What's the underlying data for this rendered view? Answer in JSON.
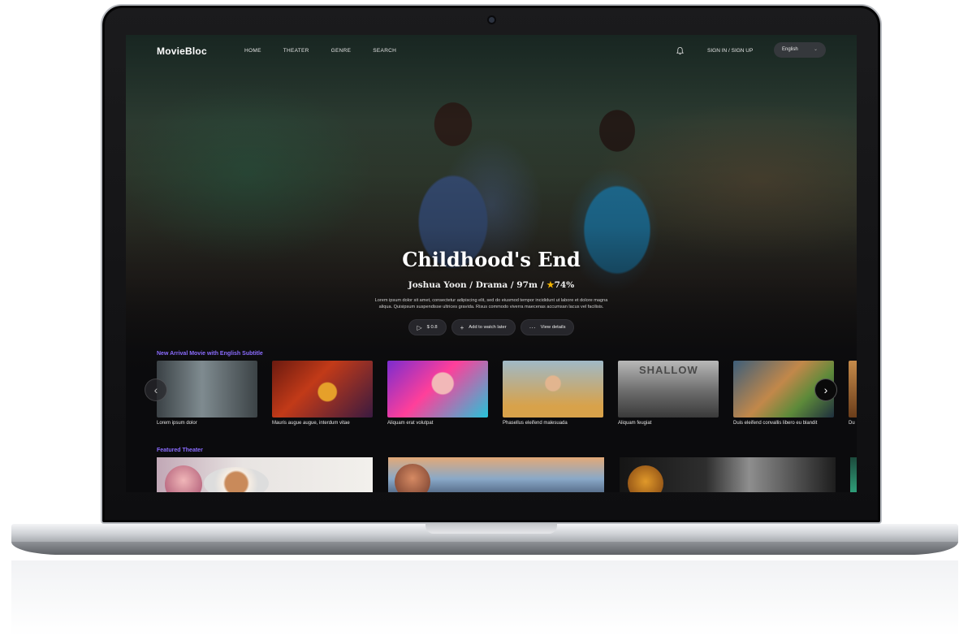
{
  "nav": {
    "logo": "MovieBloc",
    "menu": [
      "HOME",
      "THEATER",
      "GENRE",
      "SEARCH"
    ],
    "auth": "SIGN IN / SIGN UP",
    "language": "English",
    "icons": {
      "notification": "bell-icon",
      "language_dropdown": "chevron-down-icon"
    }
  },
  "hero": {
    "title": "Childhood's End",
    "director": "Joshua Yoon",
    "genre": "Drama",
    "runtime": "97m",
    "rating": "74%",
    "separator": "/",
    "description_line1": "Lorem ipsum dolor sit amet, consectetur adipiscing elit, sed do eiusmod tempor incididunt ut labore et dolore magna",
    "description_line2": "aliqua. Quisipsum suspendisse ultrices gravida. Risus commodo viverra maecenas accumsan lacus vel facilisis.",
    "actions": {
      "play_price": "$ 0.8",
      "watch_later": "Add to watch later",
      "details": "View details"
    }
  },
  "new_arrivals": {
    "heading": "New Arrival Movie with English Subtitle",
    "items": [
      {
        "caption": "Lorem ipsum dolor"
      },
      {
        "caption": "Mauris augue augue, interdum vitae"
      },
      {
        "caption": "Aliquam erat volutpat"
      },
      {
        "caption": "Phasellus eleifend malesuada"
      },
      {
        "caption": "Aliquam feugiat",
        "poster_text": "SHALLOW"
      },
      {
        "caption": "Duis eleifend convallis libero eu blandit"
      },
      {
        "caption": "Du"
      }
    ]
  },
  "featured_theater": {
    "heading": "Featured Theater"
  },
  "colors": {
    "accent": "#8b6cff",
    "star": "#f4b400",
    "background": "#0b0b0d"
  }
}
